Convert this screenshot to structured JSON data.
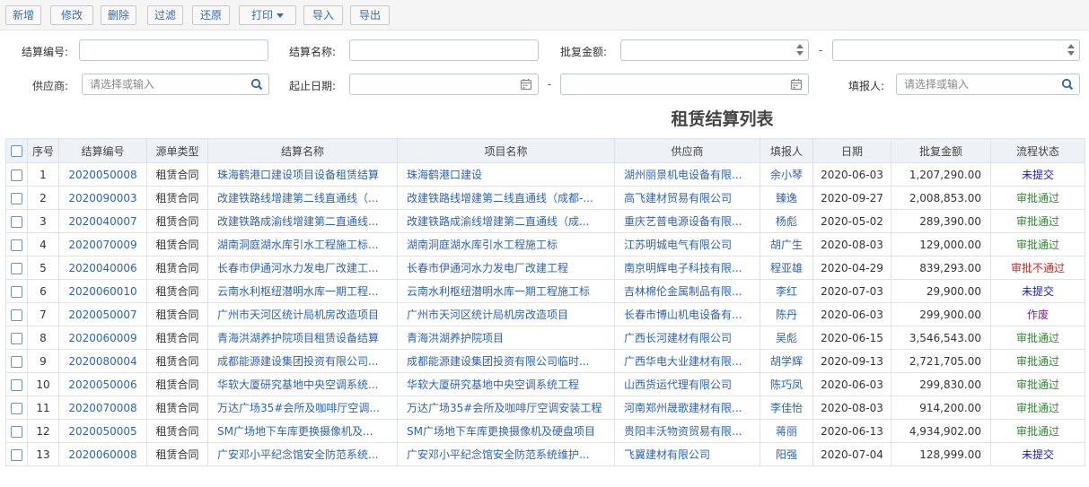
{
  "toolbar": {
    "add": "新增",
    "edit": "修改",
    "delete": "删除",
    "filter": "过滤",
    "restore": "还原",
    "print": "打印",
    "import": "导入",
    "export": "导出"
  },
  "form": {
    "settle_no_label": "结算编号:",
    "settle_no_value": "",
    "settle_name_label": "结算名称:",
    "settle_name_value": "",
    "approved_amount_label": "批复金额:",
    "amount_from": "",
    "amount_to": "",
    "range_dash": "-",
    "supplier_label": "供应商:",
    "supplier_placeholder": "请选择或输入",
    "date_label": "起止日期:",
    "date_from": "",
    "date_to": "",
    "filler_label": "填报人:",
    "filler_placeholder": "请选择或输入"
  },
  "page_title": "租赁结算列表",
  "table": {
    "headers": [
      "序号",
      "结算编号",
      "源单类型",
      "结算名称",
      "项目名称",
      "供应商",
      "填报人",
      "日期",
      "批复金额",
      "流程状态"
    ],
    "rows": [
      {
        "no": "1",
        "code": "2020050008",
        "type": "租赁合同",
        "name": "珠海鹤港口建设项目设备租赁结算",
        "project": "珠海鹤港口建设",
        "supplier": "湖州丽景机电设备有限...",
        "filler": "余小琴",
        "date": "2020-06-03",
        "amount": "1,207,290.00",
        "status": "未提交",
        "status_color": "#1a1adb"
      },
      {
        "no": "2",
        "code": "2020090003",
        "type": "租赁合同",
        "name": "改建铁路线增建第二线直通线（...",
        "project": "改建铁路线增建第二线直通线（成都-...",
        "supplier": "高飞建材贸易有限公司",
        "filler": "臻逸",
        "date": "2020-09-27",
        "amount": "2,008,853.00",
        "status": "审批通过",
        "status_color": "#2e8b2e"
      },
      {
        "no": "3",
        "code": "2020040007",
        "type": "租赁合同",
        "name": "改建铁路成渝线增建第二直通线...",
        "project": "改建铁路成渝线增建第二直通线（成...",
        "supplier": "重庆艺普电源设备有限...",
        "filler": "杨彪",
        "date": "2020-05-02",
        "amount": "289,390.00",
        "status": "审批通过",
        "status_color": "#2e8b2e"
      },
      {
        "no": "4",
        "code": "2020070009",
        "type": "租赁合同",
        "name": "湖南洞庭湖水库引水工程施工标...",
        "project": "湖南洞庭湖水库引水工程施工标",
        "supplier": "江苏明城电气有限公司",
        "filler": "胡广生",
        "date": "2020-08-03",
        "amount": "129,000.00",
        "status": "审批通过",
        "status_color": "#2e8b2e"
      },
      {
        "no": "5",
        "code": "2020040006",
        "type": "租赁合同",
        "name": "长春市伊通河水力发电厂改建工...",
        "project": "长春市伊通河水力发电厂改建工程",
        "supplier": "南京明辉电子科技有限...",
        "filler": "程亚雄",
        "date": "2020-04-29",
        "amount": "839,293.00",
        "status": "审批不通过",
        "status_color": "#e02020"
      },
      {
        "no": "6",
        "code": "2020060010",
        "type": "租赁合同",
        "name": "云南水利枢纽潜明水库一期工程...",
        "project": "云南水利枢纽潜明水库一期工程施工标",
        "supplier": "吉林棉伦金属制品有限...",
        "filler": "李红",
        "date": "2020-07-03",
        "amount": "29,900.00",
        "status": "未提交",
        "status_color": "#1a1adb"
      },
      {
        "no": "7",
        "code": "2020050007",
        "type": "租赁合同",
        "name": "广州市天河区统计局机房改造项目",
        "project": "广州市天河区统计局机房改造项目",
        "supplier": "长春市博山机电设备有...",
        "filler": "陈丹",
        "date": "2020-06-03",
        "amount": "299,900.00",
        "status": "作废",
        "status_color": "#8a1a9a"
      },
      {
        "no": "8",
        "code": "2020060009",
        "type": "租赁合同",
        "name": "青海洪湖养护院项目租赁设备结算",
        "project": "青海洪湖养护院项目",
        "supplier": "广西长河建材有限公司",
        "filler": "吴彪",
        "date": "2020-06-15",
        "amount": "3,546,543.00",
        "status": "审批通过",
        "status_color": "#2e8b2e"
      },
      {
        "no": "9",
        "code": "2020080004",
        "type": "租赁合同",
        "name": "成都能源建设集团投资有限公司...",
        "project": "成都能源建设集团投资有限公司临时...",
        "supplier": "广西华电大业建材有限...",
        "filler": "胡学辉",
        "date": "2020-09-13",
        "amount": "2,721,705.00",
        "status": "审批通过",
        "status_color": "#2e8b2e"
      },
      {
        "no": "10",
        "code": "2020050006",
        "type": "租赁合同",
        "name": "华软大厦研究基地中央空调系统...",
        "project": "华软大厦研究基地中央空调系统工程",
        "supplier": "山西货运代理有限公司",
        "filler": "陈巧凤",
        "date": "2020-06-03",
        "amount": "299,830.00",
        "status": "审批通过",
        "status_color": "#2e8b2e"
      },
      {
        "no": "11",
        "code": "2020070008",
        "type": "租赁合同",
        "name": "万达广场35#会所及咖啡厅空调...",
        "project": "万达广场35#会所及咖啡厅空调安装工程",
        "supplier": "河南郑州晟歌建材有限...",
        "filler": "李佳怡",
        "date": "2020-08-03",
        "amount": "914,200.00",
        "status": "审批通过",
        "status_color": "#2e8b2e"
      },
      {
        "no": "12",
        "code": "2020050005",
        "type": "租赁合同",
        "name": "SM广场地下车库更换摄像机及...",
        "project": "SM广场地下车库更换摄像机及硬盘项目",
        "supplier": "贵阳丰沃物资贸易有限...",
        "filler": "蒋丽",
        "date": "2020-06-13",
        "amount": "4,934,902.00",
        "status": "审批通过",
        "status_color": "#2e8b2e"
      },
      {
        "no": "13",
        "code": "2020060008",
        "type": "租赁合同",
        "name": "广安邓小平纪念馆安全防范系统...",
        "project": "广安邓小平纪念馆安全防范系统维护...",
        "supplier": "飞翼建材有限公司",
        "filler": "阳强",
        "date": "2020-07-04",
        "amount": "128,999.00",
        "status": "未提交",
        "status_color": "#1a1adb"
      }
    ]
  }
}
